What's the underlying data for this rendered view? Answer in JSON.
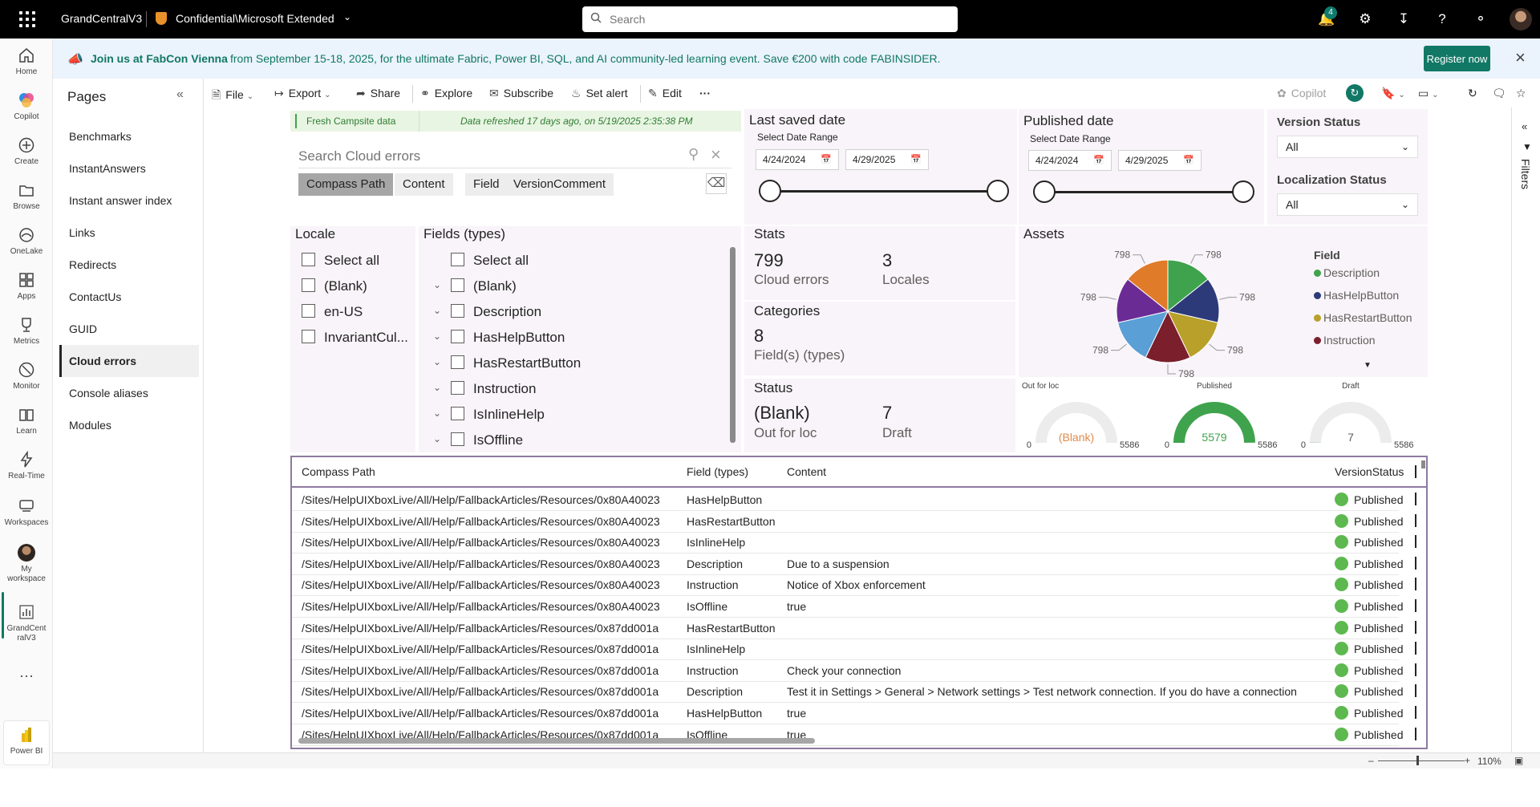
{
  "topbar": {
    "workspace": "GrandCentralV3",
    "sensitivity": "Confidential\\Microsoft Extended",
    "search_placeholder": "Search",
    "notification_count": "4"
  },
  "rail": [
    {
      "label": "Home",
      "icon": "home-icon"
    },
    {
      "label": "Copilot",
      "icon": "copilot-icon"
    },
    {
      "label": "Create",
      "icon": "create-icon"
    },
    {
      "label": "Browse",
      "icon": "folder-icon"
    },
    {
      "label": "OneLake",
      "icon": "onelake-icon"
    },
    {
      "label": "Apps",
      "icon": "apps-icon"
    },
    {
      "label": "Metrics",
      "icon": "trophy-icon"
    },
    {
      "label": "Monitor",
      "icon": "monitor-icon"
    },
    {
      "label": "Learn",
      "icon": "book-icon"
    },
    {
      "label": "Real-Time",
      "icon": "lightning-icon"
    },
    {
      "label": "Workspaces",
      "icon": "workspaces-icon"
    },
    {
      "label": "My workspace",
      "icon": "avatar"
    },
    {
      "label": "GrandCentralV3",
      "icon": "report-icon"
    },
    {
      "label": "Power BI",
      "icon": "powerbi-icon"
    }
  ],
  "banner": {
    "headline": "Join us at FabCon Vienna",
    "text": "from September 15-18, 2025, for the ultimate Fabric, Power BI, SQL, and AI community-led learning event. Save €200 with code FABINSIDER.",
    "button": "Register now"
  },
  "pages": {
    "title": "Pages",
    "items": [
      "Benchmarks",
      "InstantAnswers",
      "Instant answer index",
      "Links",
      "Redirects",
      "ContactUs",
      "GUID",
      "Cloud errors",
      "Console aliases",
      "Modules"
    ],
    "active": "Cloud errors"
  },
  "toolbar": {
    "file": "File",
    "export": "Export",
    "share": "Share",
    "explore": "Explore",
    "subscribe": "Subscribe",
    "set_alert": "Set alert",
    "edit": "Edit",
    "copilot": "Copilot"
  },
  "report": {
    "fresh_label": "Fresh Campsite data",
    "refresh_text": "Data refreshed 17 days ago, on 5/19/2025 2:35:38 PM",
    "search_placeholder": "Search Cloud errors",
    "search_tabs": [
      "Compass Path",
      "Content",
      "Field",
      "VersionComment"
    ],
    "last_saved": {
      "title": "Last saved date",
      "range_label": "Select Date Range",
      "start": "4/24/2024",
      "end": "4/29/2025"
    },
    "published": {
      "title": "Published date",
      "range_label": "Select Date Range",
      "start": "4/24/2024",
      "end": "4/29/2025"
    },
    "version_status": {
      "title": "Version Status",
      "value": "All"
    },
    "localization_status": {
      "title": "Localization Status",
      "value": "All"
    },
    "locale": {
      "title": "Locale",
      "items": [
        "Select all",
        "(Blank)",
        "en-US",
        "InvariantCul..."
      ]
    },
    "fields": {
      "title": "Fields (types)",
      "items": [
        "Select all",
        "(Blank)",
        "Description",
        "HasHelpButton",
        "HasRestartButton",
        "Instruction",
        "IsInlineHelp",
        "IsOffline"
      ]
    },
    "stats": {
      "title": "Stats",
      "cloud_errors_value": "799",
      "cloud_errors_label": "Cloud errors",
      "locales_value": "3",
      "locales_label": "Locales"
    },
    "categories": {
      "title": "Categories",
      "value": "8",
      "label": "Field(s) (types)"
    },
    "status": {
      "title": "Status",
      "blank_value": "(Blank)",
      "blank_label": "Out for loc",
      "draft_value": "7",
      "draft_label": "Draft"
    },
    "assets": {
      "title": "Assets",
      "legend_title": "Field"
    },
    "gauges": [
      {
        "title": "Out for loc",
        "value": "(Blank)",
        "min": "0",
        "max": "5586",
        "fraction": 0
      },
      {
        "title": "Published",
        "value": "5579",
        "min": "0",
        "max": "5586",
        "fraction": 0.9987
      },
      {
        "title": "Draft",
        "value": "7",
        "min": "0",
        "max": "5586",
        "fraction": 0.0013
      }
    ]
  },
  "chart_data": {
    "type": "pie",
    "title": "Assets",
    "legend_title": "Field",
    "legend_placement": "right",
    "slices": [
      {
        "name": "Description",
        "value": 798,
        "color": "#3fa34d"
      },
      {
        "name": "HasHelpButton",
        "value": 798,
        "color": "#2d3a7a"
      },
      {
        "name": "HasRestartButton",
        "value": 798,
        "color": "#b8a02a"
      },
      {
        "name": "Instruction",
        "value": 798,
        "color": "#7a1f2b"
      },
      {
        "name": "",
        "value": 798,
        "color": "#5a9fd6"
      },
      {
        "name": "",
        "value": 798,
        "color": "#6b2b95"
      },
      {
        "name": "",
        "value": 798,
        "color": "#e07b2a"
      }
    ],
    "labels": [
      "798",
      "798",
      "798",
      "798",
      "798",
      "798",
      "798"
    ]
  },
  "table": {
    "columns": [
      "Compass Path",
      "Field (types)",
      "Content",
      "VersionStatus"
    ],
    "rows": [
      [
        "/Sites/HelpUIXboxLive/All/Help/FallbackArticles/Resources/0x80A40023",
        "HasHelpButton",
        "",
        "Published"
      ],
      [
        "/Sites/HelpUIXboxLive/All/Help/FallbackArticles/Resources/0x80A40023",
        "HasRestartButton",
        "",
        "Published"
      ],
      [
        "/Sites/HelpUIXboxLive/All/Help/FallbackArticles/Resources/0x80A40023",
        "IsInlineHelp",
        "",
        "Published"
      ],
      [
        "/Sites/HelpUIXboxLive/All/Help/FallbackArticles/Resources/0x80A40023",
        "Description",
        "Due to a suspension",
        "Published"
      ],
      [
        "/Sites/HelpUIXboxLive/All/Help/FallbackArticles/Resources/0x80A40023",
        "Instruction",
        "Notice of Xbox enforcement",
        "Published"
      ],
      [
        "/Sites/HelpUIXboxLive/All/Help/FallbackArticles/Resources/0x80A40023",
        "IsOffline",
        "true",
        "Published"
      ],
      [
        "/Sites/HelpUIXboxLive/All/Help/FallbackArticles/Resources/0x87dd001a",
        "HasRestartButton",
        "",
        "Published"
      ],
      [
        "/Sites/HelpUIXboxLive/All/Help/FallbackArticles/Resources/0x87dd001a",
        "IsInlineHelp",
        "",
        "Published"
      ],
      [
        "/Sites/HelpUIXboxLive/All/Help/FallbackArticles/Resources/0x87dd001a",
        "Instruction",
        "Check your connection",
        "Published"
      ],
      [
        "/Sites/HelpUIXboxLive/All/Help/FallbackArticles/Resources/0x87dd001a",
        "Description",
        "Test it in Settings > General > Network settings > Test network connection. If you do have a connection",
        "Published"
      ],
      [
        "/Sites/HelpUIXboxLive/All/Help/FallbackArticles/Resources/0x87dd001a",
        "HasHelpButton",
        "true",
        "Published"
      ],
      [
        "/Sites/HelpUIXboxLive/All/Help/FallbackArticles/Resources/0x87dd001a",
        "IsOffline",
        "true",
        "Published"
      ]
    ]
  },
  "filters_label": "Filters",
  "zoom": "110%"
}
